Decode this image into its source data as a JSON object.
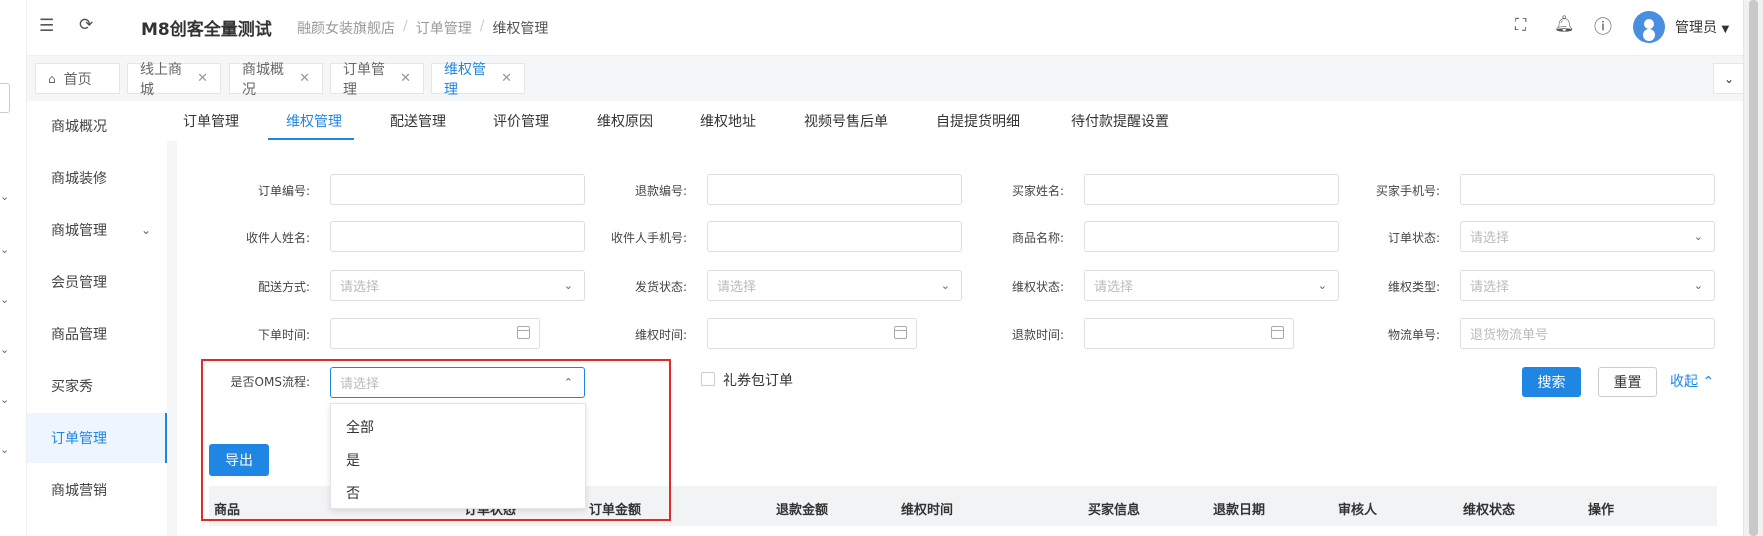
{
  "app": {
    "title": "M8创客全量测试"
  },
  "breadcrumb": [
    "融颜女装旗舰店",
    "订单管理",
    "维权管理"
  ],
  "header": {
    "user_name": "管理员"
  },
  "page_tabs": [
    {
      "label": "首页"
    },
    {
      "label": "线上商城"
    },
    {
      "label": "商城概况"
    },
    {
      "label": "订单管理"
    },
    {
      "label": "维权管理"
    }
  ],
  "side_menu": [
    {
      "label": "商城概况"
    },
    {
      "label": "商城装修"
    },
    {
      "label": "商城管理"
    },
    {
      "label": "会员管理"
    },
    {
      "label": "商品管理"
    },
    {
      "label": "买家秀"
    },
    {
      "label": "订单管理"
    },
    {
      "label": "商城营销"
    }
  ],
  "sub_tabs": [
    "订单管理",
    "维权管理",
    "配送管理",
    "评价管理",
    "维权原因",
    "维权地址",
    "视频号售后单",
    "自提提货明细",
    "待付款提醒设置"
  ],
  "filters": {
    "order_no": {
      "label": "订单编号:"
    },
    "refund_no": {
      "label": "退款编号:"
    },
    "buyer_name": {
      "label": "买家姓名:"
    },
    "buyer_phone": {
      "label": "买家手机号:"
    },
    "receiver_name": {
      "label": "收件人姓名:"
    },
    "receiver_phone": {
      "label": "收件人手机号:"
    },
    "product_name": {
      "label": "商品名称:"
    },
    "order_status": {
      "label": "订单状态:",
      "placeholder": "请选择"
    },
    "delivery_method": {
      "label": "配送方式:",
      "placeholder": "请选择"
    },
    "ship_status": {
      "label": "发货状态:",
      "placeholder": "请选择"
    },
    "rights_status": {
      "label": "维权状态:",
      "placeholder": "请选择"
    },
    "rights_type": {
      "label": "维权类型:",
      "placeholder": "请选择"
    },
    "order_time": {
      "label": "下单时间:"
    },
    "rights_time": {
      "label": "维权时间:"
    },
    "refund_time": {
      "label": "退款时间:"
    },
    "logistics_no": {
      "label": "物流单号:",
      "placeholder": "退货物流单号"
    },
    "oms": {
      "label": "是否OMS流程:",
      "placeholder": "请选择"
    },
    "gift_checkbox_label": "礼券包订单"
  },
  "dropdown_options": [
    "全部",
    "是",
    "否"
  ],
  "actions": {
    "search": "搜索",
    "reset": "重置",
    "collapse": "收起",
    "export": "导出"
  },
  "table_headers": [
    "商品",
    "订单状态",
    "订单金额",
    "退款金额",
    "维权时间",
    "买家信息",
    "退款日期",
    "审核人",
    "维权状态",
    "操作"
  ],
  "colors": {
    "primary": "#1f86e3",
    "highlight_box": "#e12b2b"
  }
}
